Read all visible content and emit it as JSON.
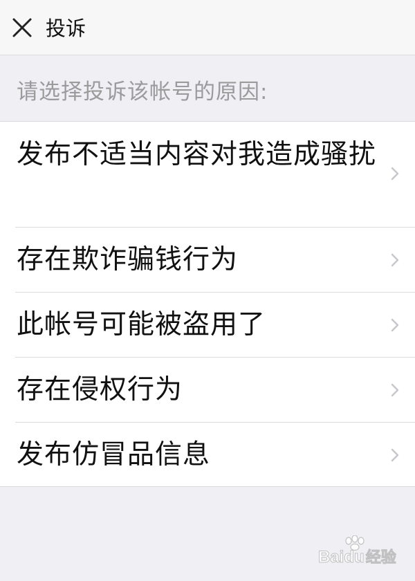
{
  "nav": {
    "title": "投诉",
    "close_icon": "close-icon"
  },
  "section_header": "请选择投诉该帐号的原因:",
  "reasons": [
    {
      "label": "发布不适当内容对我造成骚扰"
    },
    {
      "label": "存在欺诈骗钱行为"
    },
    {
      "label": "此帐号可能被盗用了"
    },
    {
      "label": "存在侵权行为"
    },
    {
      "label": "发布仿冒品信息"
    }
  ],
  "chevron_icon": "chevron-right-icon",
  "watermark": {
    "brand": "Bai",
    "brand_tail": "du",
    "product": "经验"
  },
  "colors": {
    "page_bg": "#efeff4",
    "nav_bg": "#f7f7f7",
    "list_bg": "#ffffff",
    "header_text": "#9b9b9b",
    "primary_text": "#111111",
    "chevron": "#c7c7cc"
  }
}
